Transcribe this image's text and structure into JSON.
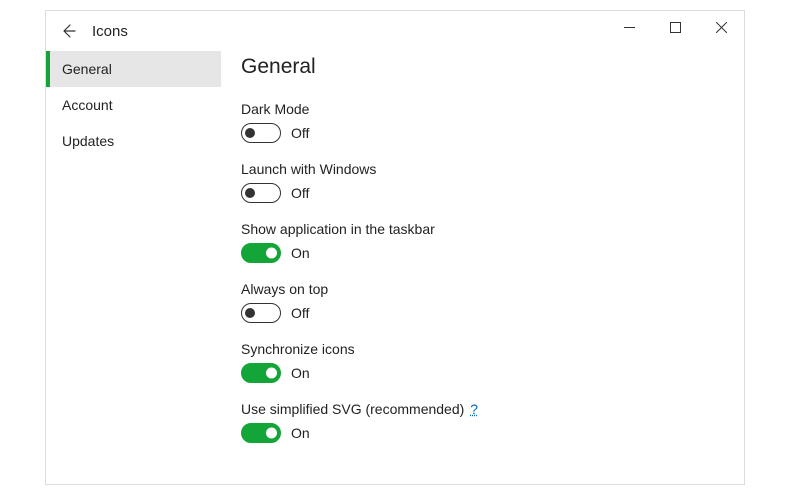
{
  "titlebar": {
    "title": "Icons"
  },
  "sidebar": {
    "items": [
      {
        "label": "General",
        "active": true
      },
      {
        "label": "Account",
        "active": false
      },
      {
        "label": "Updates",
        "active": false
      }
    ]
  },
  "content": {
    "heading": "General",
    "settings": [
      {
        "label": "Dark Mode",
        "state": "Off",
        "on": false,
        "help": false
      },
      {
        "label": "Launch with Windows",
        "state": "Off",
        "on": false,
        "help": false
      },
      {
        "label": "Show application in the taskbar",
        "state": "On",
        "on": true,
        "help": false
      },
      {
        "label": "Always on top",
        "state": "Off",
        "on": false,
        "help": false
      },
      {
        "label": "Synchronize icons",
        "state": "On",
        "on": true,
        "help": false
      },
      {
        "label": "Use simplified SVG (recommended)",
        "state": "On",
        "on": true,
        "help": true,
        "help_text": "?"
      }
    ]
  },
  "colors": {
    "accent": "#13a538"
  }
}
